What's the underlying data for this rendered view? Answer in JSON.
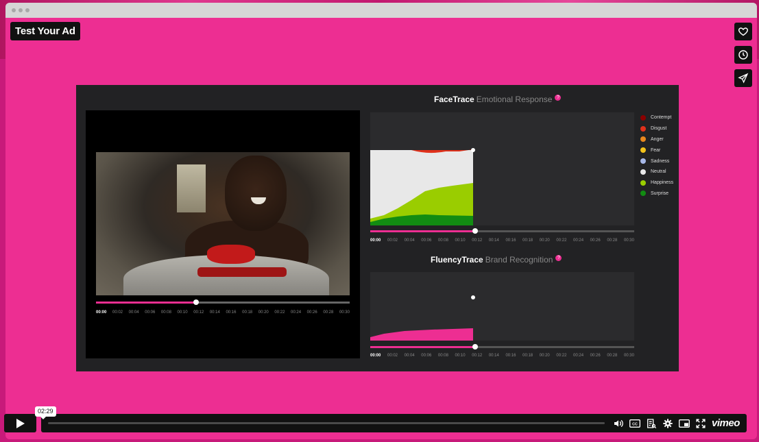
{
  "page": {
    "title": "Test Your Ad"
  },
  "sidebar_buttons": [
    {
      "name": "like",
      "icon": "heart-icon"
    },
    {
      "name": "watch-later",
      "icon": "clock-icon"
    },
    {
      "name": "share",
      "icon": "send-icon"
    }
  ],
  "video_frame": {
    "face_trace": {
      "title_bold": "FaceTrace",
      "title_sub": "Emotional Response",
      "help": "?",
      "legend": [
        {
          "label": "Contempt",
          "color": "#8b0000"
        },
        {
          "label": "Disgust",
          "color": "#e0311b"
        },
        {
          "label": "Anger",
          "color": "#e8871e"
        },
        {
          "label": "Fear",
          "color": "#f2c21b"
        },
        {
          "label": "Sadness",
          "color": "#a7b8e8"
        },
        {
          "label": "Neutral",
          "color": "#e8e8e8"
        },
        {
          "label": "Happiness",
          "color": "#9acd00"
        },
        {
          "label": "Surprise",
          "color": "#128c12"
        }
      ]
    },
    "fluency_trace": {
      "title_bold": "FluencyTrace",
      "title_sub": "Brand Recognition",
      "help": "?"
    },
    "time_ticks": [
      "00:00",
      "00:02",
      "00:04",
      "00:06",
      "00:08",
      "00:10",
      "00:12",
      "00:14",
      "00:16",
      "00:18",
      "00:20",
      "00:22",
      "00:24",
      "00:26",
      "00:28",
      "00:30"
    ],
    "progress": 0.39
  },
  "controls": {
    "tooltip_time": "02:29",
    "progress": 0.0,
    "icons": [
      "volume-icon",
      "captions-icon",
      "transcript-icon",
      "settings-icon",
      "pip-icon",
      "fullscreen-icon"
    ],
    "brand": "vimeo"
  }
}
